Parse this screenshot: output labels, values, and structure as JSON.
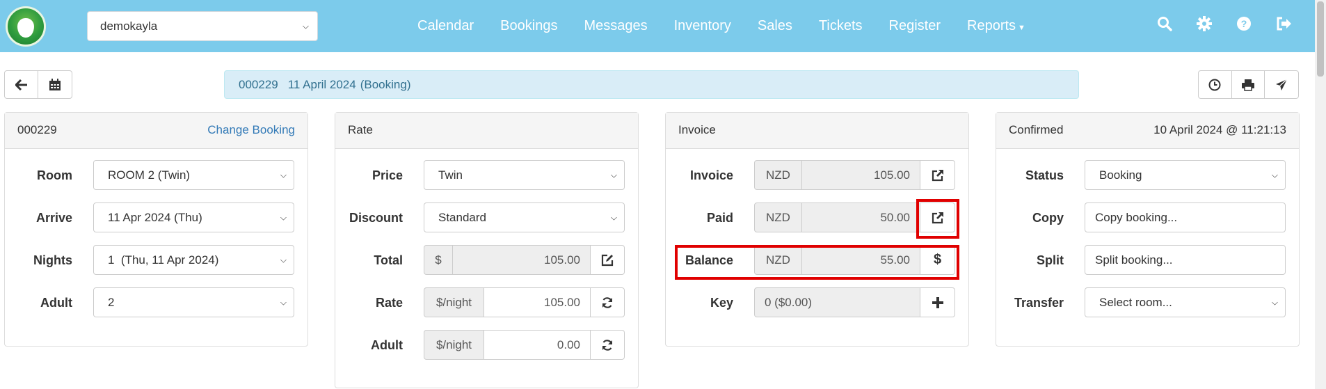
{
  "nav": {
    "property": "demokayla",
    "links": [
      "Calendar",
      "Bookings",
      "Messages",
      "Inventory",
      "Sales",
      "Tickets",
      "Register",
      "Reports"
    ],
    "icons": [
      "search-icon",
      "gear-icon",
      "help-icon",
      "logout-icon"
    ]
  },
  "title": {
    "number": "000229",
    "date": "11 April 2024",
    "type": "(Booking)"
  },
  "booking": {
    "header": "000229",
    "change": "Change Booking",
    "fields": [
      {
        "label": "Room",
        "value": "ROOM 2 (Twin)"
      },
      {
        "label": "Arrive",
        "value": "11 Apr 2024 (Thu)"
      },
      {
        "label": "Nights",
        "value": "1  (Thu, 11 Apr 2024)"
      },
      {
        "label": "Adult",
        "value": "2"
      }
    ]
  },
  "rate": {
    "header": "Rate",
    "price": {
      "label": "Price",
      "value": "Twin"
    },
    "discount": {
      "label": "Discount",
      "value": "Standard"
    },
    "total": {
      "label": "Total",
      "addon": "$",
      "value": "105.00"
    },
    "rate": {
      "label": "Rate",
      "addon": "$/night",
      "value": "105.00"
    },
    "adult": {
      "label": "Adult",
      "addon": "$/night",
      "value": "0.00"
    }
  },
  "invoice": {
    "header": "Invoice",
    "invoice": {
      "label": "Invoice",
      "currency": "NZD",
      "value": "105.00"
    },
    "paid": {
      "label": "Paid",
      "currency": "NZD",
      "value": "50.00"
    },
    "balance": {
      "label": "Balance",
      "currency": "NZD",
      "value": "55.00",
      "button": "$"
    },
    "key": {
      "label": "Key",
      "value": "0 ($0.00)"
    }
  },
  "status": {
    "header": "Confirmed",
    "timestamp": "10 April 2024 @ 11:21:13",
    "status": {
      "label": "Status",
      "value": "Booking"
    },
    "copy": {
      "label": "Copy",
      "value": "Copy booking..."
    },
    "split": {
      "label": "Split",
      "value": "Split booking..."
    },
    "transfer": {
      "label": "Transfer",
      "value": "Select room..."
    }
  },
  "colors": {
    "navbar": "#7ccbeb",
    "highlight": "#e00000",
    "info_bg": "#d9edf7",
    "link": "#337ab7"
  }
}
